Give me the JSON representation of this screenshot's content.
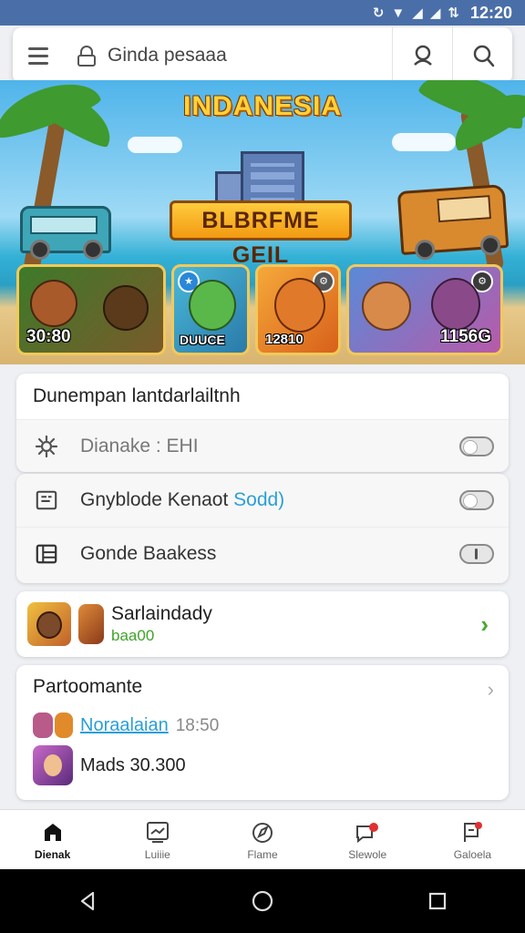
{
  "status_bar": {
    "time": "12:20",
    "icons": [
      "sync-icon",
      "wifi-icon",
      "signal-icon",
      "data-icon"
    ]
  },
  "search": {
    "text": "Ginda pesaaa"
  },
  "banner": {
    "title": "INDANESIA",
    "logo_text": "BLBRFME GEIL",
    "characters": [
      {
        "score": "30:80",
        "badge": ""
      },
      {
        "score": "DUUCE",
        "badge": ""
      },
      {
        "score": "12810",
        "badge": ""
      },
      {
        "score": "1156G",
        "badge": ""
      }
    ]
  },
  "settings": {
    "header": "Dunempan lantdarlailtnh",
    "rows": [
      {
        "label": "Dianake : EHI",
        "icon": "gear-icon",
        "toggle": false
      },
      {
        "label_main": "Gnyblode Kenaot",
        "label_accent": "Sodd)",
        "icon": "dashboard-icon",
        "toggle": false
      },
      {
        "label": "Gonde Baakess",
        "icon": "list-grid-icon",
        "toggle": false
      }
    ]
  },
  "friend": {
    "name": "Sarlaindady",
    "sub": "baa00"
  },
  "leaderboard": {
    "title": "Partoomante",
    "rows": [
      {
        "link": "Noraalaian",
        "time": "18:50"
      },
      {
        "text": "Mads 30.300"
      }
    ]
  },
  "bottom_nav": [
    {
      "label": "Dienak",
      "icon": "home-icon",
      "active": true
    },
    {
      "label": "Luiiie",
      "icon": "chart-icon",
      "active": false
    },
    {
      "label": "Flame",
      "icon": "compass-icon",
      "active": false
    },
    {
      "label": "Slewole",
      "icon": "chat-notify-icon",
      "active": false
    },
    {
      "label": "Galoela",
      "icon": "flag-notify-icon",
      "active": false
    }
  ]
}
